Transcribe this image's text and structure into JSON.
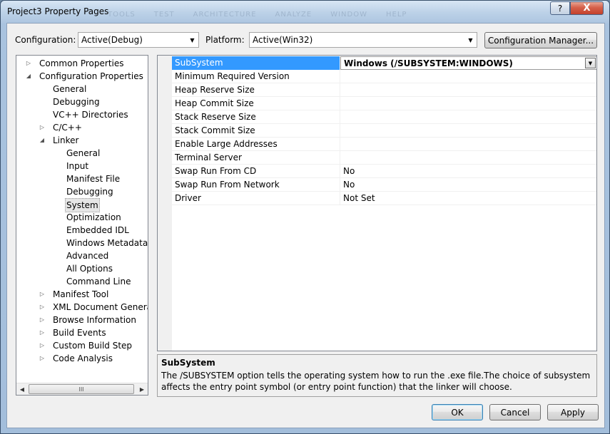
{
  "window": {
    "title": "Project3 Property Pages",
    "background_menu": [
      "TOOLS",
      "TEST",
      "ARCHITECTURE",
      "ANALYZE",
      "WINDOW",
      "HELP"
    ],
    "help_label": "?",
    "close_label": "X"
  },
  "config": {
    "configuration_label": "Configuration:",
    "configuration_value": "Active(Debug)",
    "platform_label": "Platform:",
    "platform_value": "Active(Win32)",
    "manager_button": "Configuration Manager..."
  },
  "tree": {
    "items": [
      {
        "label": "Common Properties",
        "level": 0,
        "expander": "collapsed"
      },
      {
        "label": "Configuration Properties",
        "level": 0,
        "expander": "expanded"
      },
      {
        "label": "General",
        "level": 1,
        "expander": "none"
      },
      {
        "label": "Debugging",
        "level": 1,
        "expander": "none"
      },
      {
        "label": "VC++ Directories",
        "level": 1,
        "expander": "none"
      },
      {
        "label": "C/C++",
        "level": 1,
        "expander": "collapsed"
      },
      {
        "label": "Linker",
        "level": 1,
        "expander": "expanded"
      },
      {
        "label": "General",
        "level": 2,
        "expander": "none"
      },
      {
        "label": "Input",
        "level": 2,
        "expander": "none"
      },
      {
        "label": "Manifest File",
        "level": 2,
        "expander": "none"
      },
      {
        "label": "Debugging",
        "level": 2,
        "expander": "none"
      },
      {
        "label": "System",
        "level": 2,
        "expander": "none",
        "selected": true
      },
      {
        "label": "Optimization",
        "level": 2,
        "expander": "none"
      },
      {
        "label": "Embedded IDL",
        "level": 2,
        "expander": "none"
      },
      {
        "label": "Windows Metadata",
        "level": 2,
        "expander": "none"
      },
      {
        "label": "Advanced",
        "level": 2,
        "expander": "none"
      },
      {
        "label": "All Options",
        "level": 2,
        "expander": "none"
      },
      {
        "label": "Command Line",
        "level": 2,
        "expander": "none"
      },
      {
        "label": "Manifest Tool",
        "level": 1,
        "expander": "collapsed"
      },
      {
        "label": "XML Document Generator",
        "level": 1,
        "expander": "collapsed"
      },
      {
        "label": "Browse Information",
        "level": 1,
        "expander": "collapsed"
      },
      {
        "label": "Build Events",
        "level": 1,
        "expander": "collapsed"
      },
      {
        "label": "Custom Build Step",
        "level": 1,
        "expander": "collapsed"
      },
      {
        "label": "Code Analysis",
        "level": 1,
        "expander": "collapsed"
      }
    ],
    "scroll_thumb_grip": "III"
  },
  "properties": [
    {
      "name": "SubSystem",
      "value": "Windows (/SUBSYSTEM:WINDOWS)",
      "selected": true
    },
    {
      "name": "Minimum Required Version",
      "value": ""
    },
    {
      "name": "Heap Reserve Size",
      "value": ""
    },
    {
      "name": "Heap Commit Size",
      "value": ""
    },
    {
      "name": "Stack Reserve Size",
      "value": ""
    },
    {
      "name": "Stack Commit Size",
      "value": ""
    },
    {
      "name": "Enable Large Addresses",
      "value": ""
    },
    {
      "name": "Terminal Server",
      "value": ""
    },
    {
      "name": "Swap Run From CD",
      "value": "No"
    },
    {
      "name": "Swap Run From Network",
      "value": "No"
    },
    {
      "name": "Driver",
      "value": "Not Set"
    }
  ],
  "description": {
    "title": "SubSystem",
    "text": "The /SUBSYSTEM option tells the operating system how to run the .exe file.The choice of subsystem affects the entry point symbol (or entry point function) that the linker will choose."
  },
  "buttons": {
    "ok": "OK",
    "cancel": "Cancel",
    "apply": "Apply"
  },
  "colors": {
    "selection": "#3399ff",
    "dialog_bg": "#f0f0f0"
  }
}
